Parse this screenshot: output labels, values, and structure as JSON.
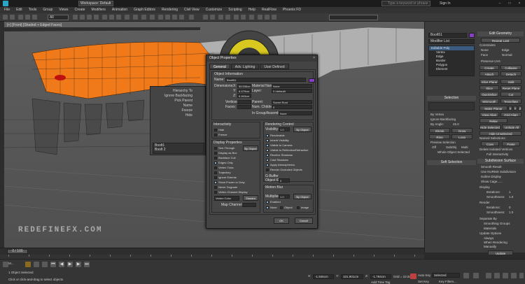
{
  "titlebar": {
    "workspace": "Workspace: Default",
    "search_placeholder": "Type a keyword or phrase",
    "sign_in": "Sign In"
  },
  "menubar": [
    "File",
    "Edit",
    "Tools",
    "Group",
    "Views",
    "Create",
    "Modifiers",
    "Animation",
    "Graph Editors",
    "Rendering",
    "Civil View",
    "Customize",
    "Scripting",
    "Help",
    "RealFlow",
    "Phoenix FD"
  ],
  "toolbar": {
    "selection_filter": "All"
  },
  "viewport": {
    "label": "[+] [Front] [Shaded + Edged Faces]",
    "watermark": "REDEFINEFX.COM"
  },
  "minidlg": {
    "rows": [
      "Hierarchy To",
      "Ignore Backfacing",
      "Pick Parent",
      "Name",
      "Freeze",
      "Hide"
    ],
    "list": [
      "Boolt1",
      "Boolt 2"
    ]
  },
  "dialog": {
    "title": "Object Properties",
    "tabs": [
      "General",
      "Adv. Lighting",
      "User Defined"
    ],
    "object_information": {
      "header": "Object Information",
      "name_label": "Name:",
      "name_value": "Boolt51",
      "dimensions_label": "Dimensions:",
      "dims": [
        "55.536cm",
        "6.479cm",
        "6.463cm"
      ],
      "material_name_label": "Material Name:",
      "material_name": "None",
      "layer_label": "Layer:",
      "layer": "0 (default)",
      "vertices_label": "Vertices:",
      "faces_label": "Faces:",
      "parent_label": "Parent:",
      "parent": "Scene Root",
      "num_children_label": "Num. Children:",
      "num_children": "0",
      "group_label": "In Group/Assembly:",
      "group": "None"
    },
    "interactivity": {
      "header": "Interactivity",
      "items": [
        "Hide",
        "Freeze"
      ]
    },
    "display_properties": {
      "header": "Display Properties",
      "by_object": "By Object",
      "items": [
        "See-Through",
        "Display as Box",
        "Backface Cull",
        "Edges Only",
        "Vertex Ticks",
        "Trajectory",
        "Ignore Extents",
        "Show Frozen in Gray",
        "Never Degrade",
        "Vertex Channel Display"
      ],
      "vertex_color": "Vertex Color",
      "shaded": "Shaded",
      "map_channel_label": "Map Channel:"
    },
    "rendering_control": {
      "header": "Rendering Control",
      "visibility_label": "Visibility:",
      "visibility": "1.0",
      "by_object": "By Object",
      "items": [
        "Renderable",
        "Inherit Visibility",
        "Visible to Camera",
        "Visible to Reflection/Refraction",
        "Receive Shadows",
        "Cast Shadows",
        "Apply Atmospherics",
        "Render Occluded Objects"
      ]
    },
    "gbuffer": {
      "header": "G-Buffer",
      "object_id_label": "Object ID:",
      "object_id": "0"
    },
    "motion_blur": {
      "header": "Motion Blur",
      "multiplier_label": "Multiplier:",
      "multiplier": "1.0",
      "by_object": "By Object",
      "enabled": "Enabled",
      "options": [
        "None",
        "Object",
        "Image"
      ]
    },
    "ok": "OK",
    "cancel": "Cancel"
  },
  "command_panel": {
    "object_name": "Boolt51",
    "modifier_list": "Modifier List",
    "stack": [
      "Editable Poly",
      "Vertex",
      "Edge",
      "Border",
      "Polygon",
      "Element"
    ],
    "edit_geometry": {
      "header": "Edit Geometry",
      "repeat_last": "Repeat Last",
      "constraints_label": "Constraints",
      "constraints": [
        "None",
        "Edge",
        "Face",
        "Normal"
      ],
      "preserve_uvs": "Preserve UVs",
      "buttons": [
        "Create",
        "Collapse",
        "Attach",
        "Detach",
        "Slice Plane",
        "Split",
        "Slice",
        "Reset Plane",
        "QuickSlice",
        "Cut",
        "MSmooth",
        "Tessellate",
        "Make Planar",
        "X",
        "Y",
        "Z",
        "View Align",
        "Grid Align",
        "Relax",
        "Hide Selected",
        "Unhide All",
        "Hide Unselected"
      ],
      "named_selections": "Named Selections:",
      "copy": "Copy",
      "paste": "Paste",
      "delete_isolated": "Delete Isolated Vertices",
      "full_interactivity": "Full Interactivity"
    },
    "selection": {
      "header": "Selection",
      "by_vertex": "By Vertex",
      "ignore_backfacing": "Ignore Backfacing",
      "by_angle": "By Angle:",
      "angle": "45.0",
      "shrink": "Shrink",
      "grow": "Grow",
      "ring": "Ring",
      "loop": "Loop",
      "preview_selection": "Preview Selection",
      "preview_options": [
        "Off",
        "SubObj",
        "Multi"
      ],
      "whole_object_selected": "Whole Object Selected"
    },
    "soft_selection": {
      "header": "Soft Selection"
    },
    "subdivision_surface": {
      "header": "Subdivision Surface",
      "items": [
        "Smooth Result",
        "Use NURMS Subdivision",
        "Isoline Display",
        "Show Cage......"
      ],
      "display_label": "Display",
      "iterations_label": "Iterations:",
      "iterations": "1",
      "smoothness_label": "Smoothness:",
      "smoothness": "1.0",
      "render_label": "Render",
      "render_iterations": "0",
      "render_smoothness": "1.0",
      "separate_by": "Separate By",
      "separate_items": [
        "Smoothing Groups",
        "Materials"
      ],
      "update_options": "Update Options",
      "update_items": [
        "Always",
        "When Rendering",
        "Manually"
      ],
      "update_button": "Update"
    },
    "bottom_header": "Subdivision Displacement"
  },
  "timeline": {
    "frame": "0 / 100"
  },
  "status": {
    "objects": "1 Object Selected",
    "prompt": "Click or click-and-drag to select objects",
    "x": "-1.946cm",
    "y": "101.901cm",
    "z": "-1.794cm",
    "grid": "Grid = 10.0cm",
    "add_time_tag": "Add Time Tag",
    "auto_key": "Auto Key",
    "set_key": "Set Key",
    "selected": "Selected",
    "key_filters": "Key Filters...",
    "listener": "M..."
  },
  "colors": {
    "accent": "#8a3dc8",
    "car_orange": "#f07a1a",
    "key_red": "#c04040"
  }
}
